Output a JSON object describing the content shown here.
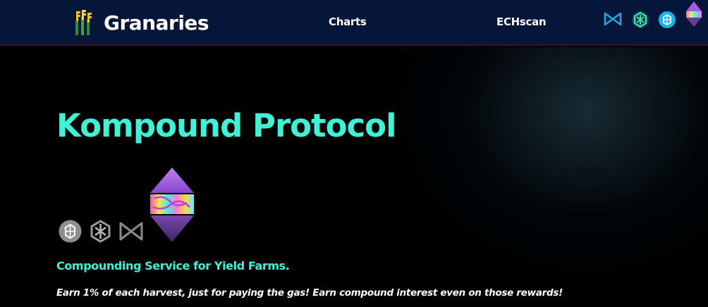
{
  "nav": {
    "brand_name": "Granaries",
    "links": [
      "Charts",
      "ECHscan"
    ],
    "chain_icons": [
      "bow-tie-network-icon",
      "cube-network-icon",
      "fantom-network-icon",
      "ethereum-gem-icon"
    ]
  },
  "hero": {
    "title": "Kompound Protocol",
    "subtitle": "Compounding Service for Yield Farms.",
    "description": "Earn 1% of each harvest, just for paying the gas! Earn compound interest even on those rewards!",
    "protocol_icons": [
      "fantom-network-icon",
      "cube-network-icon",
      "bow-tie-network-icon"
    ]
  },
  "colors": {
    "accent": "#3ff2d6",
    "navbar_bg": "#06153a",
    "page_bg": "#000000",
    "gem_purple": "#9b59d8"
  }
}
